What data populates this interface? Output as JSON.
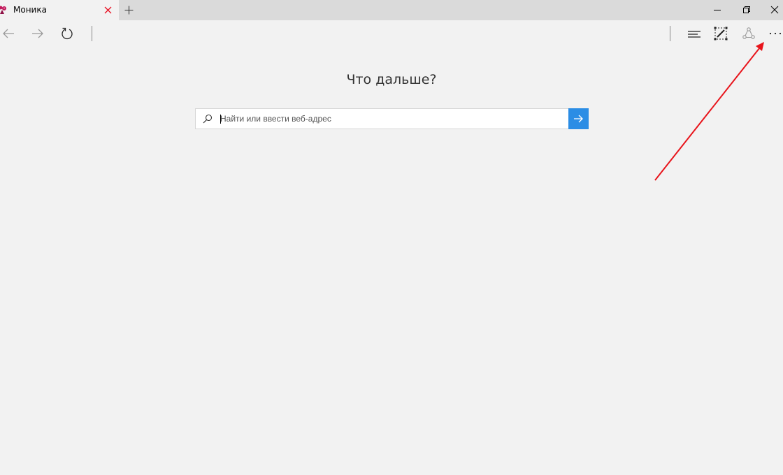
{
  "tab": {
    "title": "Моника",
    "favicon": "monica-favicon-icon",
    "close_icon": "close-icon"
  },
  "new_tab_icon": "plus-icon",
  "window_controls": [
    "minimize-icon",
    "restore-icon",
    "close-icon"
  ],
  "navbar": {
    "left_icons": [
      "back-arrow-icon",
      "forward-arrow-icon",
      "refresh-icon"
    ],
    "right_icons": [
      "hub-icon",
      "web-note-icon",
      "share-icon",
      "more-icon"
    ]
  },
  "page": {
    "heading": "Что дальше?"
  },
  "search": {
    "placeholder": "Найти или ввести веб-адрес",
    "value": ""
  },
  "colors": {
    "accent": "#2b8de5",
    "background": "#f2f2f2",
    "titlebar": "#dadada",
    "annotation_arrow": "#e8141b",
    "favicon": "#c2185b"
  }
}
